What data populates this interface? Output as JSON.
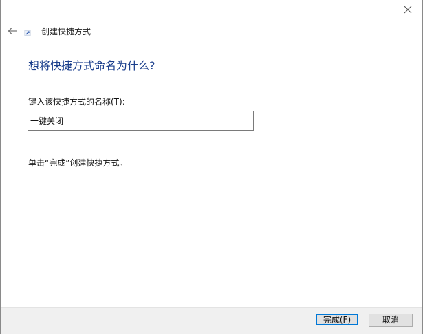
{
  "window": {
    "title": "创建快捷方式"
  },
  "page": {
    "heading": "想将快捷方式命名为什么?",
    "name_label": "键入该快捷方式的名称(T):",
    "name_value": "一键关闭",
    "hint": "单击“完成”创建快捷方式。"
  },
  "buttons": {
    "finish_label": "完成(F)",
    "cancel_label": "取消"
  },
  "icons": {
    "close": "close-icon",
    "back": "back-arrow-icon",
    "shortcut": "shortcut-icon"
  },
  "colors": {
    "heading": "#1a3e8c",
    "primary_border": "#0078d7",
    "footer_bg": "#f0f0f0"
  }
}
